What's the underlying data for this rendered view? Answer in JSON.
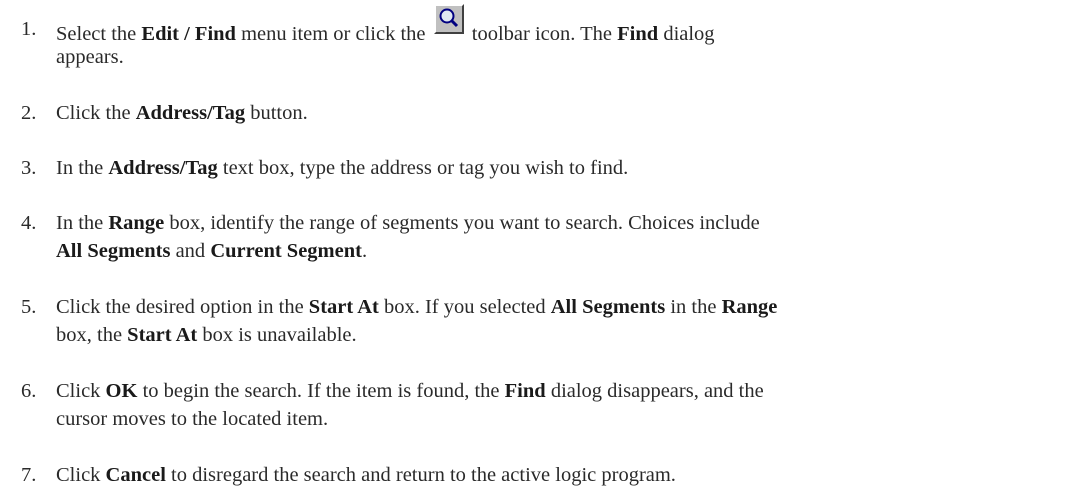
{
  "steps": [
    {
      "num": "1.",
      "parts": [
        "Select the ",
        "Edit / Find",
        " menu item or click the ",
        " toolbar icon. The ",
        "Find",
        " dialog",
        "appears."
      ],
      "icon": "magnifier-icon"
    },
    {
      "num": "2.",
      "parts": [
        "Click the ",
        "Address/Tag",
        " button."
      ]
    },
    {
      "num": "3.",
      "parts": [
        "In the ",
        "Address/Tag",
        " text box, type the address or tag you wish to find."
      ]
    },
    {
      "num": "4.",
      "parts": [
        "In the ",
        "Range",
        " box, identify the range of segments you want to search. Choices include",
        "All Segments",
        " and ",
        "Current Segment",
        "."
      ]
    },
    {
      "num": "5.",
      "parts": [
        "Click the desired option in the ",
        "Start At",
        " box. If you selected ",
        "All Segments",
        " in the ",
        "Range",
        "box, the ",
        "Start At",
        " box is unavailable."
      ]
    },
    {
      "num": "6.",
      "parts": [
        "Click ",
        "OK",
        " to begin the search. If the item is found, the ",
        "Find",
        " dialog disappears, and the",
        "cursor moves to the located item."
      ]
    },
    {
      "num": "7.",
      "parts": [
        "Click ",
        "Cancel",
        " to disregard the search and return to the active logic program."
      ]
    }
  ]
}
